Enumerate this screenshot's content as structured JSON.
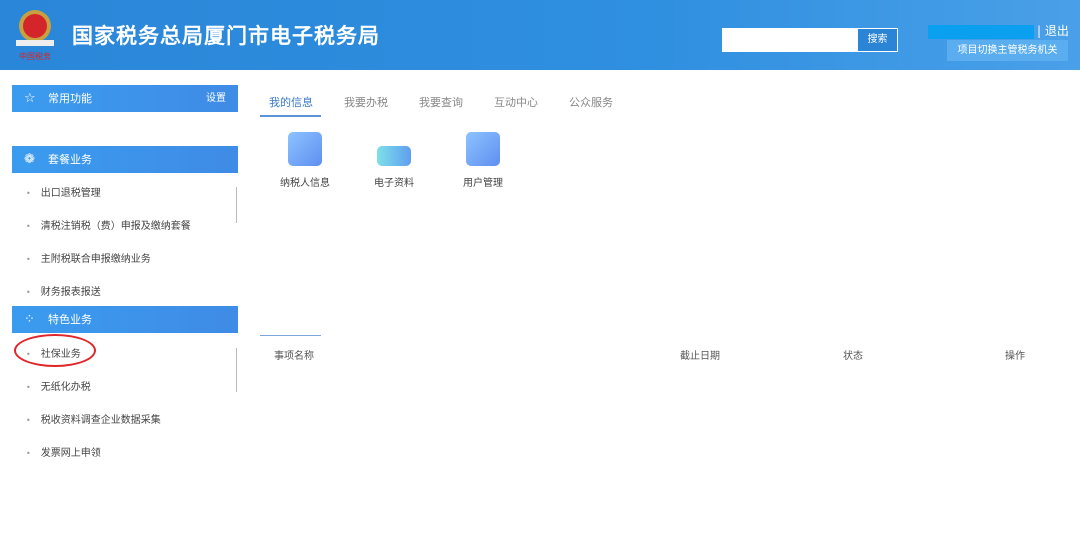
{
  "header": {
    "title": "国家税务总局厦门市电子税务局",
    "logo_text": "中国税务",
    "search_placeholder": "",
    "search_label": "搜索",
    "logout": "| 退出",
    "switch_label": "项目切换主管税务机关"
  },
  "sidebar": {
    "common": {
      "title": "常用功能",
      "action": "设置"
    },
    "package": {
      "title": "套餐业务",
      "items": [
        "出口退税管理",
        "清税注销税（费）申报及缴纳套餐",
        "主附税联合申报缴纳业务",
        "财务报表报送"
      ]
    },
    "special": {
      "title": "特色业务",
      "items": [
        "社保业务",
        "无纸化办税",
        "税收资料调查企业数据采集",
        "发票网上申领"
      ]
    }
  },
  "tabs": [
    "我的信息",
    "我要办税",
    "我要查询",
    "互动中心",
    "公众服务"
  ],
  "apps": [
    {
      "label": "纳税人信息",
      "icon": "taxpayer-info-icon"
    },
    {
      "label": "电子资料",
      "icon": "printer-icon"
    },
    {
      "label": "用户管理",
      "icon": "user-management-icon"
    }
  ],
  "table": {
    "headers": [
      "事项名称",
      "截止日期",
      "状态",
      "操作"
    ]
  }
}
